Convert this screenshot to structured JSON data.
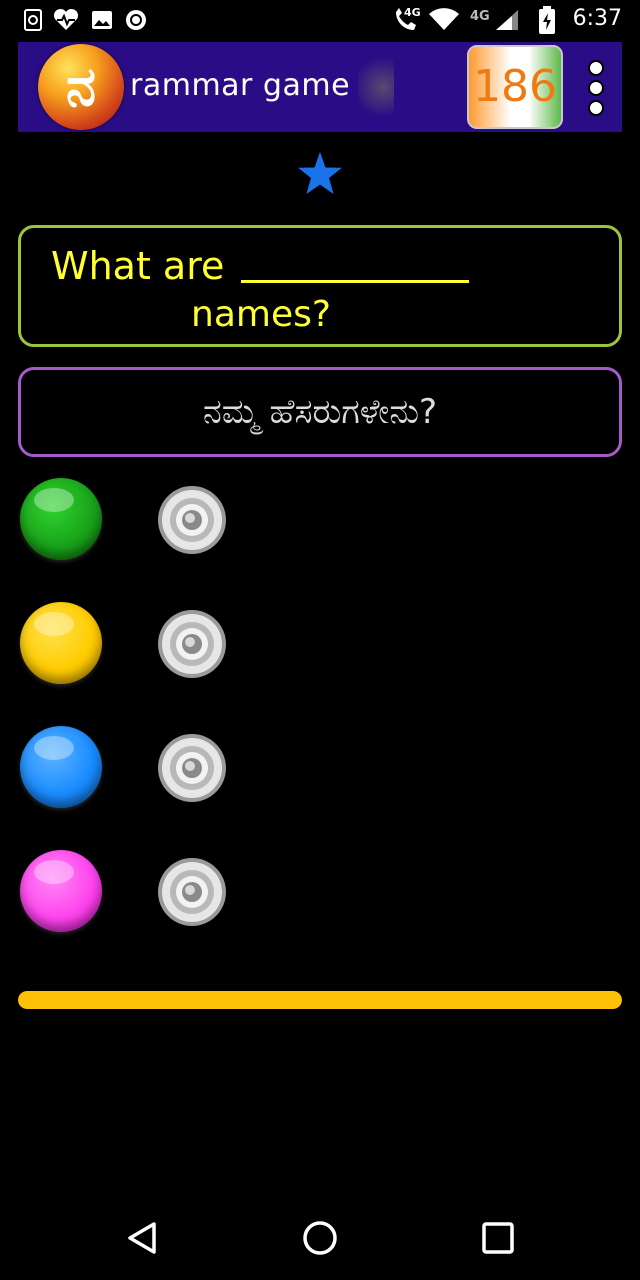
{
  "status_bar": {
    "time": "6:37",
    "network_labels": [
      "4G",
      "4G"
    ],
    "icons": [
      "screen-rotate-icon",
      "health-icon",
      "image-icon",
      "record-icon",
      "wifi-call-icon",
      "wifi-icon",
      "signal-icon",
      "battery-icon"
    ]
  },
  "app_bar": {
    "logo_glyph": "ನ",
    "title": "rammar game [",
    "score": "186",
    "menu_icon": "more-vertical-icon"
  },
  "stars": {
    "count": 1,
    "color": "#1a73e8"
  },
  "question": {
    "line1": "What are",
    "line2": "names?",
    "color": "#ffff33",
    "border_color": "#9bc53d"
  },
  "translation": {
    "text": "ನಮ್ಮ ಹೆಸರುಗಳೇನು?",
    "border_color": "#a25bc8"
  },
  "options": [
    {
      "color": "#1aa31a",
      "icon": "speaker-icon"
    },
    {
      "color": "#ffcc00",
      "icon": "speaker-icon"
    },
    {
      "color": "#1a8cff",
      "icon": "speaker-icon"
    },
    {
      "color": "#ff44ee",
      "icon": "speaker-icon"
    }
  ],
  "progress": {
    "fraction": 1.0,
    "color": "#ffc107"
  },
  "nav_bar": {
    "icons": [
      "back-icon",
      "home-icon",
      "recents-icon"
    ]
  }
}
